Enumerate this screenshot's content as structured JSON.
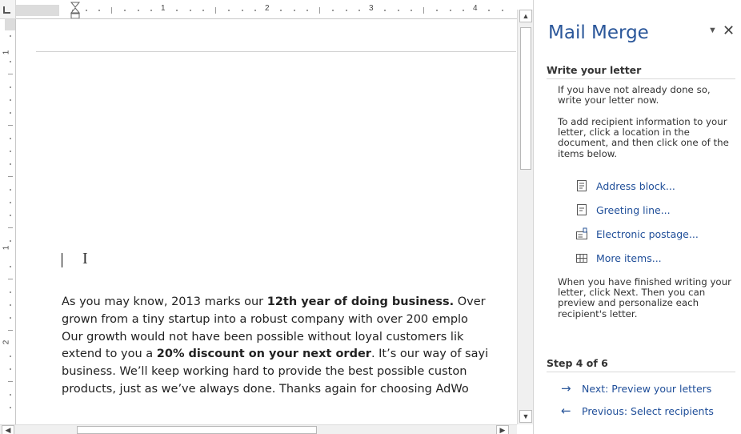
{
  "ruler": {
    "h_numbers": [
      "1",
      "2",
      "3",
      "4"
    ],
    "v_numbers": [
      "1",
      "1",
      "2"
    ]
  },
  "document": {
    "lines": [
      [
        {
          "t": "As you may know, 2013 marks our "
        },
        {
          "t": "12th year of doing business.",
          "b": true
        },
        {
          "t": " Over"
        }
      ],
      [
        {
          "t": "grown from a tiny startup into a robust company with over 200 emplo"
        }
      ],
      [
        {
          "t": "Our growth would not have been possible without loyal customers lik"
        }
      ],
      [
        {
          "t": "extend to you a "
        },
        {
          "t": "20% discount on your next order",
          "b": true
        },
        {
          "t": ". It’s our way of sayi"
        }
      ],
      [
        {
          "t": "business. We’ll keep working hard to provide the best possible custon"
        }
      ],
      [
        {
          "t": "products, just as we’ve always done. Thanks again for choosing AdWo"
        }
      ]
    ]
  },
  "pane": {
    "title": "Mail Merge",
    "menu_glyph": "▼",
    "close_glyph": "✕",
    "section_write": "Write your letter",
    "para1": "If you have not already done so, write your letter now.",
    "para2": "To add recipient information to your letter, click a location in the document, and then click one of the items below.",
    "items": [
      {
        "label": "Address block...",
        "icon": "address-block-icon"
      },
      {
        "label": "Greeting line...",
        "icon": "greeting-line-icon"
      },
      {
        "label": "Electronic postage...",
        "icon": "electronic-postage-icon"
      },
      {
        "label": "More items...",
        "icon": "more-items-icon"
      }
    ],
    "para3": "When you have finished writing your letter, click Next. Then you can preview and personalize each recipient's letter.",
    "step": "Step 4 of 6",
    "next_label": "Next: Preview your letters",
    "prev_label": "Previous: Select recipients",
    "accent": "#2b579a",
    "link_color": "#1f4e99"
  }
}
